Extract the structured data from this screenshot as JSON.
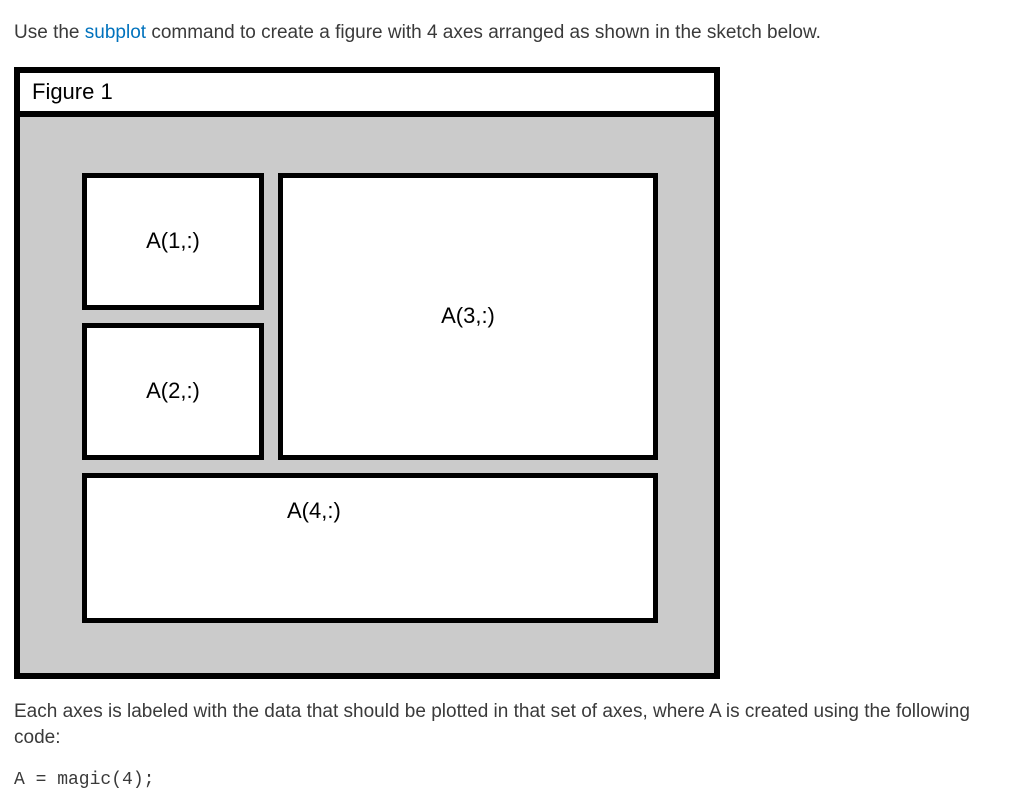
{
  "instruction": {
    "prefix": "Use the ",
    "link_text": "subplot",
    "middle": " command to create a figure with 4 axes arranged as shown in the sketch below."
  },
  "figure": {
    "title": "Figure 1",
    "axes": {
      "ax1_label": "A(1,:)",
      "ax2_label": "A(2,:)",
      "ax3_label": "A(3,:)",
      "ax4_label": "A(4,:)"
    }
  },
  "caption": "Each axes is labeled with the data that should be plotted in that set of axes, where A is created using the following code:",
  "code_line": "A = magic(4);"
}
